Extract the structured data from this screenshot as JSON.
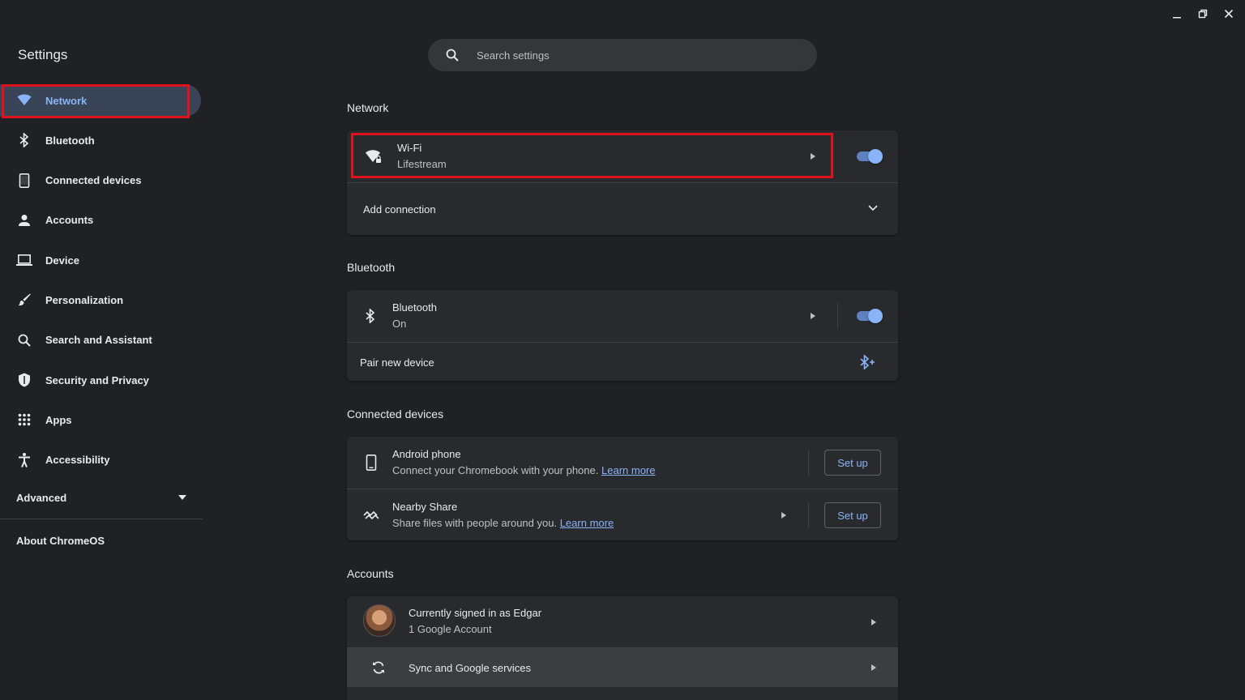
{
  "app": {
    "title": "Settings"
  },
  "search": {
    "placeholder": "Search settings"
  },
  "sidebar": {
    "items": [
      {
        "label": "Network",
        "icon": "wifi-icon",
        "active": true
      },
      {
        "label": "Bluetooth",
        "icon": "bluetooth-icon"
      },
      {
        "label": "Connected devices",
        "icon": "phone-icon"
      },
      {
        "label": "Accounts",
        "icon": "person-icon"
      },
      {
        "label": "Device",
        "icon": "laptop-icon"
      },
      {
        "label": "Personalization",
        "icon": "brush-icon"
      },
      {
        "label": "Search and Assistant",
        "icon": "search-icon"
      },
      {
        "label": "Security and Privacy",
        "icon": "shield-icon"
      },
      {
        "label": "Apps",
        "icon": "apps-grid-icon"
      },
      {
        "label": "Accessibility",
        "icon": "accessibility-icon"
      }
    ],
    "advanced": "Advanced",
    "about": "About ChromeOS"
  },
  "network": {
    "title": "Network",
    "wifi": {
      "label": "Wi-Fi",
      "sub": "Lifestream",
      "enabled": true
    },
    "add_connection": "Add connection"
  },
  "bluetooth": {
    "title": "Bluetooth",
    "toggle_row": {
      "label": "Bluetooth",
      "sub": "On",
      "enabled": true
    },
    "pair": "Pair new device"
  },
  "connected": {
    "title": "Connected devices",
    "android": {
      "label": "Android phone",
      "sub": "Connect your Chromebook with your phone.",
      "link": "Learn more",
      "button": "Set up"
    },
    "nearby": {
      "label": "Nearby Share",
      "sub": "Share files with people around you.",
      "link": "Learn more",
      "button": "Set up"
    }
  },
  "accounts": {
    "title": "Accounts",
    "signed_in": {
      "label": "Currently signed in as Edgar",
      "sub": "1 Google Account"
    },
    "sync": "Sync and Google services"
  },
  "colors": {
    "accent": "#8ab4f8",
    "highlight": "#e0121b",
    "background": "#202124",
    "card": "#292a2d"
  }
}
